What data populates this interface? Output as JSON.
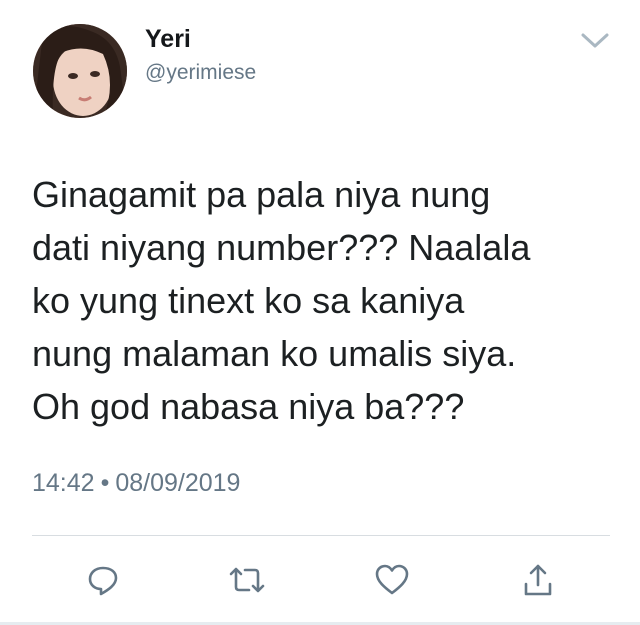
{
  "tweet": {
    "author": {
      "display_name": "Yeri",
      "handle": "@yerimiese"
    },
    "text": "Ginagamit pa pala niya nung\ndati niyang number??? Naalala\nko yung tinext ko sa kaniya\nnung malaman ko umalis siya.\nOh god nabasa niya ba???",
    "time": "14:42",
    "separator": "•",
    "date": "08/09/2019"
  },
  "actions": {
    "reply_icon": "reply-icon",
    "retweet_icon": "retweet-icon",
    "like_icon": "heart-icon",
    "share_icon": "share-icon"
  },
  "colors": {
    "text": "#14171a",
    "secondary": "#657786",
    "icon": "#657786",
    "divider": "#d8dde1"
  }
}
